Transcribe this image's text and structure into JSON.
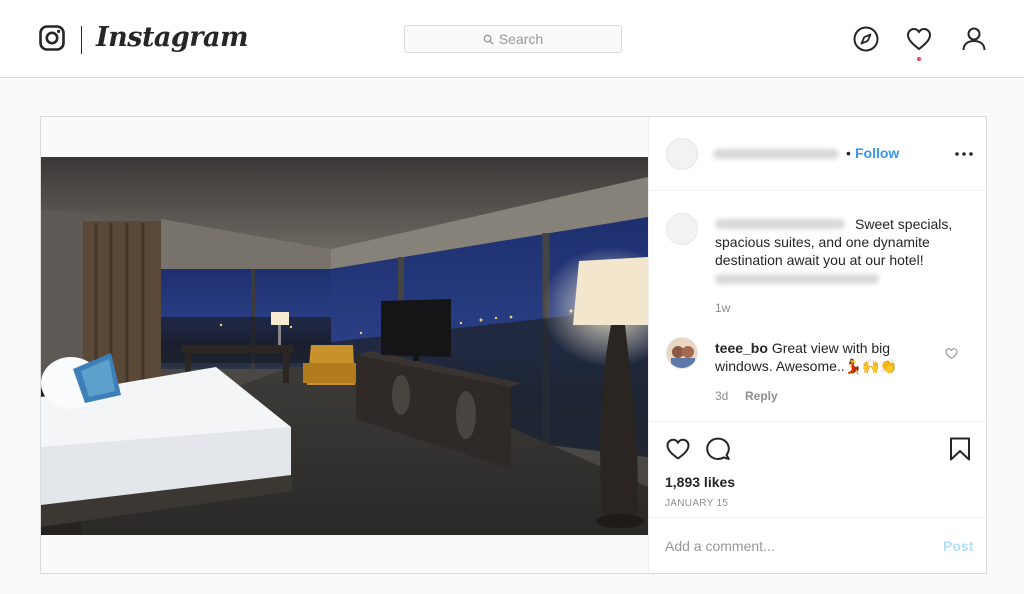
{
  "app": {
    "brand": "Instagram",
    "accent_color": "#3897f0",
    "notification_color": "#ed4956"
  },
  "topnav": {
    "search_placeholder": "Search",
    "icons": [
      "instagram-glyph-icon",
      "search-icon",
      "explore-compass-icon",
      "activity-heart-icon",
      "profile-icon"
    ]
  },
  "post": {
    "header": {
      "follow_separator": "•",
      "follow_label": "Follow",
      "more_icon": "more-horizontal-icon"
    },
    "caption": {
      "text_line1": "Sweet specials,",
      "text_rest": "spacious suites, and one dynamite destination await you at our hotel!",
      "time": "1w"
    },
    "comments": [
      {
        "user": "teee_bo",
        "text": "Great view with big windows. Awesome..",
        "emoji": "💃🙌👏",
        "time": "3d",
        "reply_label": "Reply"
      }
    ],
    "actions": {
      "icons": [
        "like-heart-icon",
        "comment-bubble-icon",
        "save-bookmark-icon"
      ],
      "likes": "1,893 likes",
      "date": "JANUARY 15"
    },
    "add_comment": {
      "placeholder": "Add a comment...",
      "post_label": "Post"
    }
  }
}
